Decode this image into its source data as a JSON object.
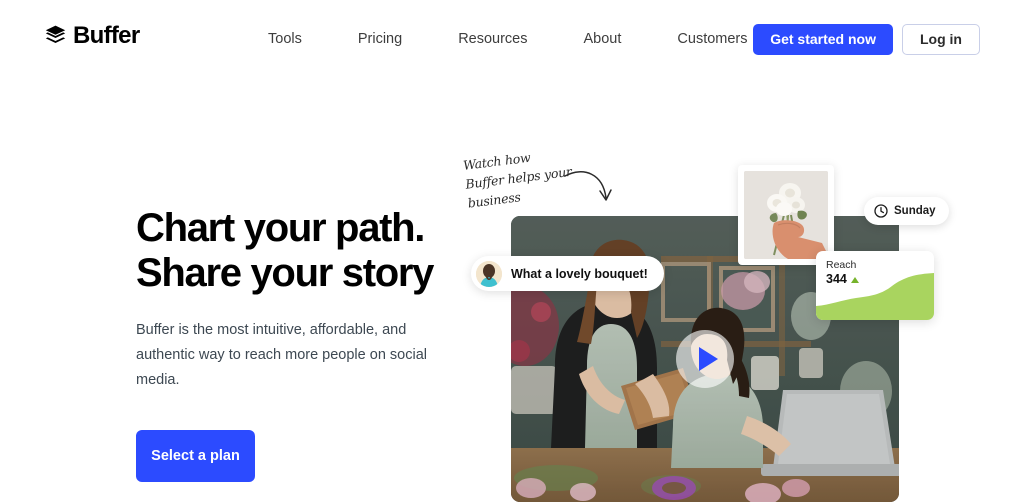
{
  "brand": {
    "name": "Buffer",
    "logo_icon": "buffer-layers-icon",
    "accent_blue": "#2C4BFF",
    "accent_green": "#A9D45F",
    "text_dark": "#000000",
    "body_text": "#3d4852"
  },
  "header": {
    "nav_items": [
      {
        "label": "Tools"
      },
      {
        "label": "Pricing"
      },
      {
        "label": "Resources"
      },
      {
        "label": "About"
      },
      {
        "label": "Customers"
      }
    ],
    "get_started_label": "Get started now",
    "login_label": "Log in"
  },
  "hero": {
    "title_line1": "Chart your path.",
    "title_line2": "Share your story",
    "subtitle": "Buffer is the most intuitive, affordable, and authentic way to reach more people on social media.",
    "cta_label": "Select a plan"
  },
  "annotation": {
    "text": "Watch how Buffer helps your business",
    "arrow_icon": "curved-arrow-icon"
  },
  "media": {
    "play_icon": "play-icon",
    "alt": "Two women in a flower shop looking at a tablet"
  },
  "cards": {
    "photo": {
      "alt": "Hand holding white roses",
      "icon": "photo-card"
    },
    "day": {
      "icon": "clock-icon",
      "label": "Sunday"
    },
    "reach": {
      "label": "Reach",
      "value": "344",
      "trend_icon": "triangle-up-icon",
      "trend_direction": "up",
      "chart_color": "#A9D45F"
    },
    "comment": {
      "avatar_icon": "user-avatar",
      "text": "What a lovely bouquet!"
    }
  }
}
